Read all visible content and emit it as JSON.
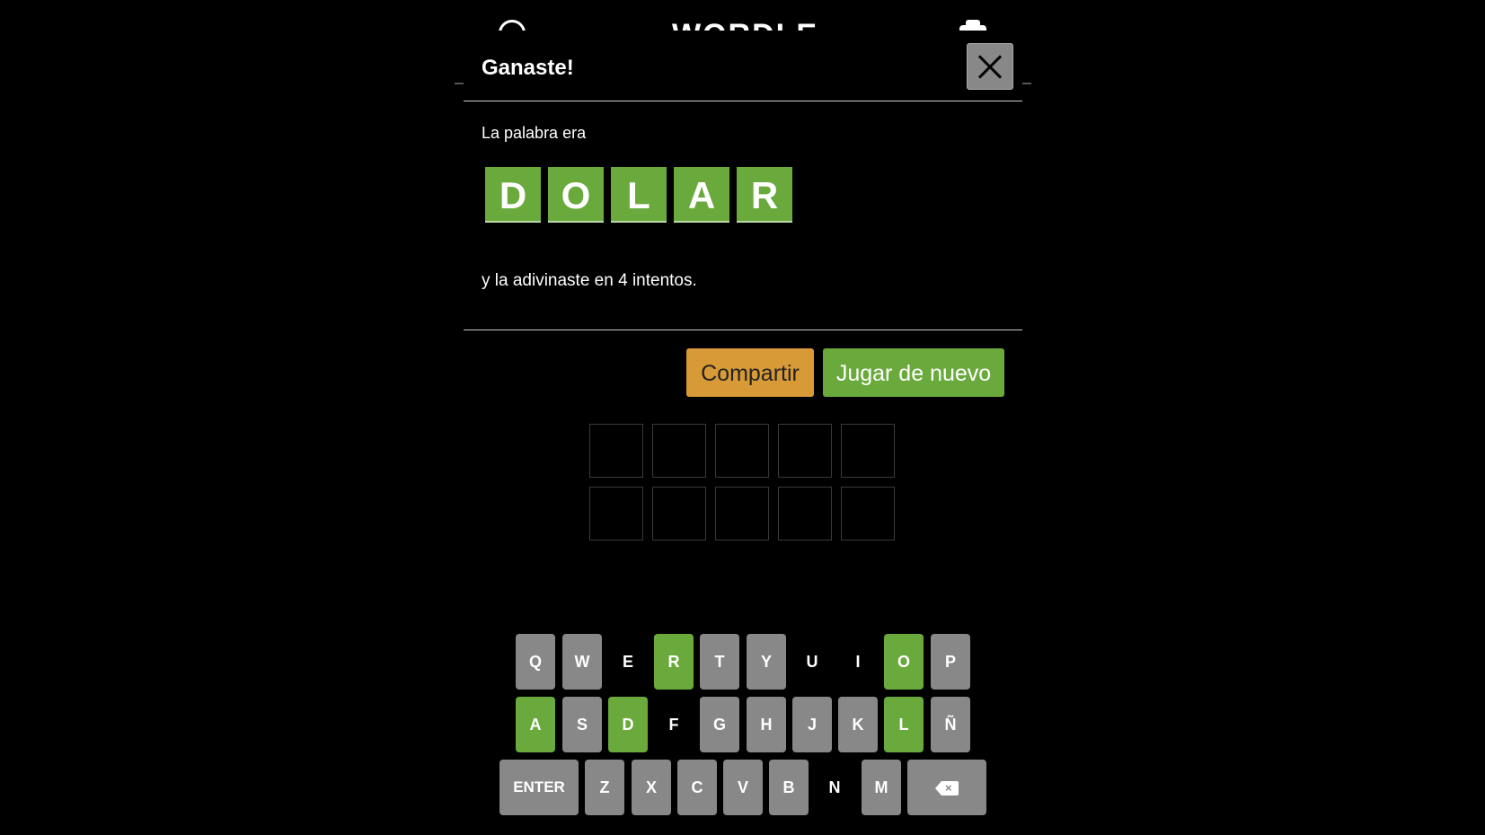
{
  "header": {
    "title": "WORDLE",
    "left_icon": "help-circle-icon",
    "right_icon": "settings-icon"
  },
  "modal": {
    "title": "Ganaste!",
    "close_icon": "close-icon",
    "subtitle": "La palabra era",
    "answer": [
      "D",
      "O",
      "L",
      "A",
      "R"
    ],
    "result": "y la adivinaste en 4 intentos.",
    "share_label": "Compartir",
    "play_again_label": "Jugar de nuevo"
  },
  "colors": {
    "correct": "#6aaa3c",
    "present": "#d89a36",
    "used": "#888888",
    "absent": "#000000"
  },
  "keyboard": {
    "row1": [
      {
        "label": "Q",
        "state": "used"
      },
      {
        "label": "W",
        "state": "used"
      },
      {
        "label": "E",
        "state": "absent"
      },
      {
        "label": "R",
        "state": "correct"
      },
      {
        "label": "T",
        "state": "used"
      },
      {
        "label": "Y",
        "state": "used"
      },
      {
        "label": "U",
        "state": "absent"
      },
      {
        "label": "I",
        "state": "absent"
      },
      {
        "label": "O",
        "state": "correct"
      },
      {
        "label": "P",
        "state": "used"
      }
    ],
    "row2": [
      {
        "label": "A",
        "state": "correct"
      },
      {
        "label": "S",
        "state": "used"
      },
      {
        "label": "D",
        "state": "correct"
      },
      {
        "label": "F",
        "state": "absent"
      },
      {
        "label": "G",
        "state": "used"
      },
      {
        "label": "H",
        "state": "used"
      },
      {
        "label": "J",
        "state": "used"
      },
      {
        "label": "K",
        "state": "used"
      },
      {
        "label": "L",
        "state": "correct"
      },
      {
        "label": "Ñ",
        "state": "used"
      }
    ],
    "row3": [
      {
        "label": "ENTER",
        "state": "used"
      },
      {
        "label": "Z",
        "state": "used"
      },
      {
        "label": "X",
        "state": "used"
      },
      {
        "label": "C",
        "state": "used"
      },
      {
        "label": "V",
        "state": "used"
      },
      {
        "label": "B",
        "state": "used"
      },
      {
        "label": "N",
        "state": "absent"
      },
      {
        "label": "M",
        "state": "used"
      },
      {
        "label": "",
        "state": "used",
        "icon": "backspace-icon"
      }
    ]
  }
}
